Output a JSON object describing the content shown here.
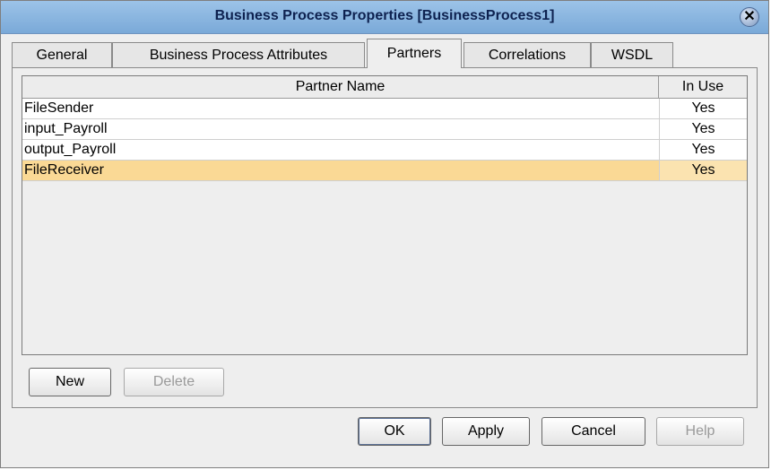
{
  "window": {
    "title": "Business Process Properties [BusinessProcess1]",
    "close_glyph": "✕"
  },
  "tabs": [
    {
      "label": "General"
    },
    {
      "label": "Business Process Attributes"
    },
    {
      "label": "Partners",
      "active": true
    },
    {
      "label": "Correlations"
    },
    {
      "label": "WSDL"
    }
  ],
  "table": {
    "columns": [
      "Partner Name",
      "In Use"
    ],
    "rows": [
      {
        "name": "FileSender",
        "in_use": "Yes"
      },
      {
        "name": "input_Payroll",
        "in_use": "Yes"
      },
      {
        "name": "output_Payroll",
        "in_use": "Yes"
      },
      {
        "name": "FileReceiver",
        "in_use": "Yes",
        "selected": true
      }
    ],
    "selection_color": "#fad995"
  },
  "panel_buttons": {
    "new": "New",
    "delete": "Delete"
  },
  "dialog_buttons": {
    "ok": "OK",
    "apply": "Apply",
    "cancel": "Cancel",
    "help": "Help"
  }
}
